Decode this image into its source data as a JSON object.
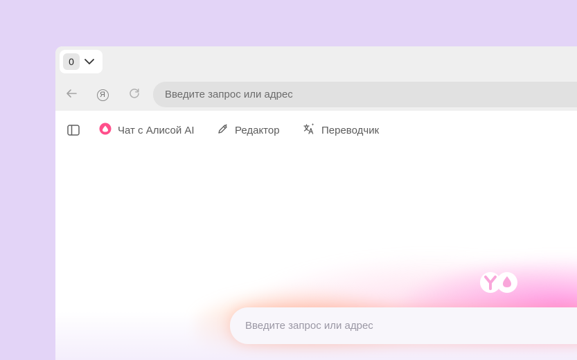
{
  "tabbar": {
    "tab_count": "0"
  },
  "toolbar": {
    "ya_glyph": "Я",
    "address_placeholder": "Введите запрос или адрес"
  },
  "bookmarks": {
    "items": [
      {
        "label": "Чат с Алисой AI",
        "icon": "alice-icon"
      },
      {
        "label": "Редактор",
        "icon": "pen-icon"
      },
      {
        "label": "Переводчик",
        "icon": "translate-icon"
      }
    ]
  },
  "newtab": {
    "search_placeholder": "Введите запрос или адрес"
  },
  "colors": {
    "backdrop": "#e3d4f7",
    "alice_accent": "#ff4f8b",
    "glow_pink": "#ff82dc",
    "glow_orange": "#ffaa82"
  }
}
